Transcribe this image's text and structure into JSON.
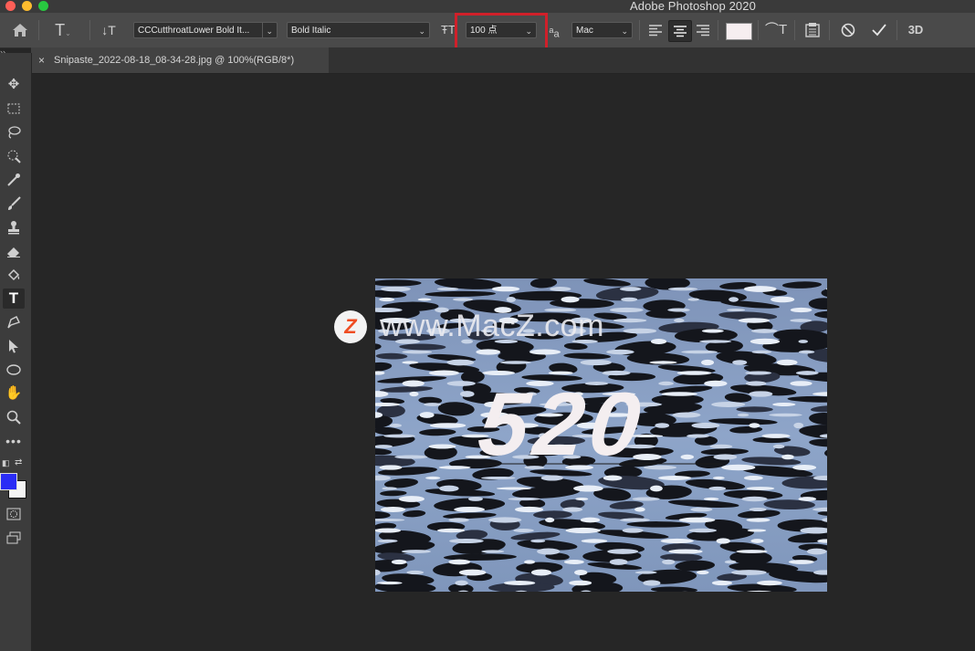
{
  "window": {
    "title": "Adobe Photoshop 2020",
    "traffic_lights": [
      "#fe5f57",
      "#febc2e",
      "#28c840"
    ]
  },
  "options_bar": {
    "font_family": "CCCutthroatLower Bold It...",
    "font_style": "Bold Italic",
    "font_size": "100 点",
    "anti_alias": "Mac",
    "text_color": "#f6eef0",
    "highlight_color": "#d0202a",
    "label_3d": "3D"
  },
  "document": {
    "tab_label": "Snipaste_2022-08-18_08-34-28.jpg @ 100%(RGB/8*)"
  },
  "toolbox": {
    "foreground_color": "#2a2cf5",
    "background_color": "#f4f4f4",
    "active_tool": "type-tool"
  },
  "canvas": {
    "watermark_logo": "Z",
    "watermark_text": "www.MacZ.com",
    "text_layer": "520"
  }
}
